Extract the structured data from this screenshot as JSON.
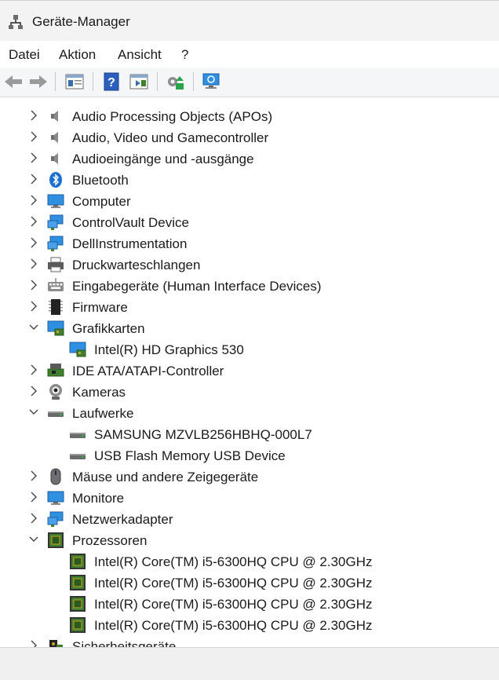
{
  "window": {
    "title": "Geräte-Manager"
  },
  "menu": [
    "Datei",
    "Aktion",
    "Ansicht",
    "?"
  ],
  "toolbar": [
    "back",
    "forward",
    "properties",
    "help",
    "update-driver",
    "scan-hardware",
    "monitor"
  ],
  "tree": [
    {
      "label": "Audio Processing Objects (APOs)",
      "icon": "speaker-icon",
      "state": "collapsed",
      "level": 0
    },
    {
      "label": "Audio, Video und Gamecontroller",
      "icon": "speaker-icon",
      "state": "collapsed",
      "level": 0
    },
    {
      "label": "Audioeingänge und -ausgänge",
      "icon": "speaker-icon",
      "state": "collapsed",
      "level": 0
    },
    {
      "label": "Bluetooth",
      "icon": "bluetooth-icon",
      "state": "collapsed",
      "level": 0
    },
    {
      "label": "Computer",
      "icon": "monitor-icon",
      "state": "collapsed",
      "level": 0
    },
    {
      "label": "ControlVault Device",
      "icon": "network-monitor-icon",
      "state": "collapsed",
      "level": 0
    },
    {
      "label": "DellInstrumentation",
      "icon": "network-monitor-icon",
      "state": "collapsed",
      "level": 0
    },
    {
      "label": "Druckwarteschlangen",
      "icon": "printer-icon",
      "state": "collapsed",
      "level": 0
    },
    {
      "label": "Eingabegeräte (Human Interface Devices)",
      "icon": "keyboard-icon",
      "state": "collapsed",
      "level": 0
    },
    {
      "label": "Firmware",
      "icon": "chip-icon",
      "state": "collapsed",
      "level": 0
    },
    {
      "label": "Grafikkarten",
      "icon": "display-adapter-icon",
      "state": "expanded",
      "level": 0
    },
    {
      "label": "Intel(R) HD Graphics 530",
      "icon": "display-adapter-icon",
      "state": "leaf",
      "level": 1
    },
    {
      "label": "IDE ATA/ATAPI-Controller",
      "icon": "controller-icon",
      "state": "collapsed",
      "level": 0
    },
    {
      "label": "Kameras",
      "icon": "camera-icon",
      "state": "collapsed",
      "level": 0
    },
    {
      "label": "Laufwerke",
      "icon": "drive-icon",
      "state": "expanded",
      "level": 0
    },
    {
      "label": "SAMSUNG MZVLB256HBHQ-000L7",
      "icon": "drive-icon",
      "state": "leaf",
      "level": 1
    },
    {
      "label": "USB Flash Memory USB Device",
      "icon": "drive-icon",
      "state": "leaf",
      "level": 1
    },
    {
      "label": "Mäuse und andere Zeigegeräte",
      "icon": "mouse-icon",
      "state": "collapsed",
      "level": 0
    },
    {
      "label": "Monitore",
      "icon": "monitor-icon",
      "state": "collapsed",
      "level": 0
    },
    {
      "label": "Netzwerkadapter",
      "icon": "network-monitor-icon",
      "state": "collapsed",
      "level": 0
    },
    {
      "label": "Prozessoren",
      "icon": "processor-icon",
      "state": "expanded",
      "level": 0
    },
    {
      "label": "Intel(R) Core(TM) i5-6300HQ CPU @ 2.30GHz",
      "icon": "processor-icon",
      "state": "leaf",
      "level": 1
    },
    {
      "label": "Intel(R) Core(TM) i5-6300HQ CPU @ 2.30GHz",
      "icon": "processor-icon",
      "state": "leaf",
      "level": 1
    },
    {
      "label": "Intel(R) Core(TM) i5-6300HQ CPU @ 2.30GHz",
      "icon": "processor-icon",
      "state": "leaf",
      "level": 1
    },
    {
      "label": "Intel(R) Core(TM) i5-6300HQ CPU @ 2.30GHz",
      "icon": "processor-icon",
      "state": "leaf",
      "level": 1
    },
    {
      "label": "Sicherheitsgeräte",
      "icon": "security-icon",
      "state": "collapsed",
      "level": 0
    }
  ],
  "colors": {
    "accent": "#1a7fd4",
    "chip_green": "#3f7f2e",
    "monitor_blue": "#2f8fe0"
  }
}
